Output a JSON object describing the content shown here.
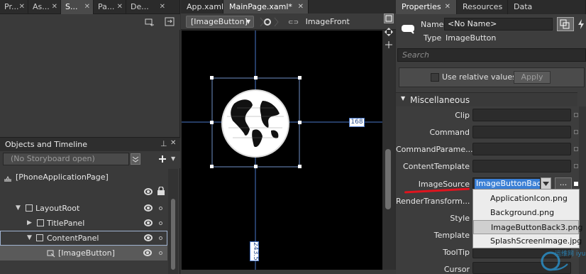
{
  "left_panel": {
    "tabs": [
      {
        "label": "Pr..."
      },
      {
        "label": "As..."
      },
      {
        "label": "S..."
      },
      {
        "label": "Pa..."
      },
      {
        "label": "De..."
      }
    ],
    "objects_header": "Objects and Timeline",
    "storyboard_placeholder": "(No Storyboard open)",
    "tree": [
      {
        "label": "[PhoneApplicationPage]"
      },
      {
        "label": "LayoutRoot"
      },
      {
        "label": "TitlePanel"
      },
      {
        "label": "ContentPanel"
      },
      {
        "label": "[ImageButton]"
      }
    ]
  },
  "center": {
    "doc_tabs": [
      {
        "label": "App.xaml"
      },
      {
        "label": "MainPage.xaml*"
      }
    ],
    "breadcrumb": {
      "element": "[ImageButton]",
      "template": "ImageFront"
    },
    "measure_right": "168",
    "measure_bottom": "243.5"
  },
  "right_panel": {
    "tabs": [
      {
        "label": "Properties"
      },
      {
        "label": "Resources"
      },
      {
        "label": "Data"
      }
    ],
    "name_label": "Name",
    "name_value": "<No Name>",
    "type_label": "Type",
    "type_value": "ImageButton",
    "search_placeholder": "Search",
    "use_relative_label": "Use relative values",
    "apply_label": "Apply",
    "section_title": "Miscellaneous",
    "properties": [
      {
        "label": "Clip"
      },
      {
        "label": "Command"
      },
      {
        "label": "CommandParame..."
      },
      {
        "label": "ContentTemplate"
      },
      {
        "label": "ImageSource",
        "value": "ImageButtonBack"
      },
      {
        "label": "RenderTransform..."
      },
      {
        "label": "Style"
      },
      {
        "label": "Template"
      },
      {
        "label": "ToolTip"
      },
      {
        "label": "Cursor"
      }
    ],
    "browse_label": "...",
    "dropdown_options": [
      {
        "label": "ApplicationIcon.png"
      },
      {
        "label": "Background.png"
      },
      {
        "label": "ImageButtonBack3.png"
      },
      {
        "label": "SplashScreenImage.jpg"
      }
    ],
    "watermark": "运维网 iyunv.com"
  },
  "colors": {
    "selection_blue": "#3a7fd5",
    "underline_red": "#e0141e",
    "guide_blue": "#4a78c8"
  }
}
